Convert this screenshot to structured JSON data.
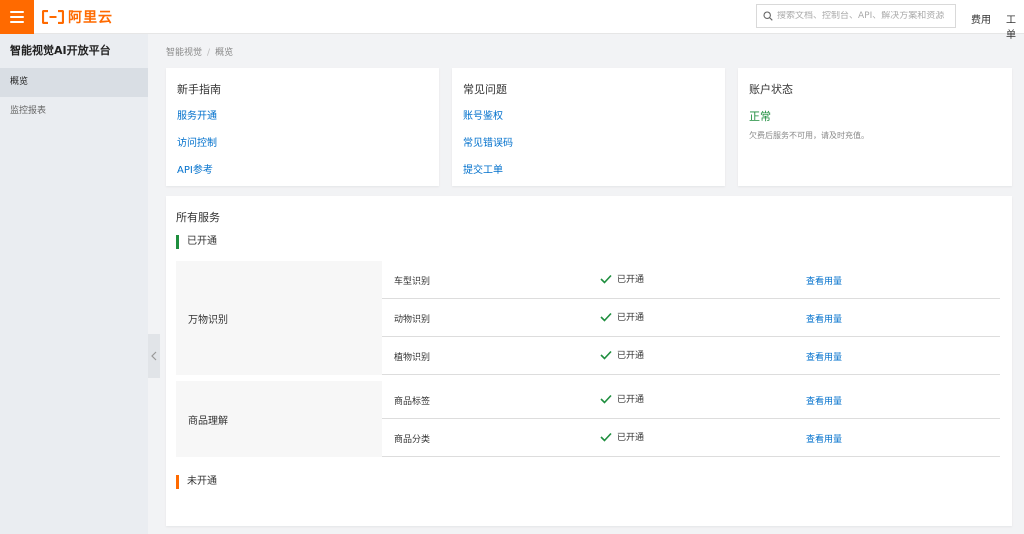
{
  "topbar": {
    "logo_text": "阿里云",
    "search_placeholder": "搜索文档、控制台、API、解决方案和资源",
    "links": [
      "费用",
      "工单"
    ],
    "brand_color": "#ff6a00"
  },
  "sidebar": {
    "title": "智能视觉AI开放平台",
    "items": [
      {
        "label": "概览",
        "active": true
      },
      {
        "label": "监控报表",
        "active": false
      }
    ]
  },
  "breadcrumb": [
    "智能视觉",
    "概览"
  ],
  "cards": {
    "guide": {
      "title": "新手指南",
      "links": [
        "服务开通",
        "访问控制",
        "API参考"
      ]
    },
    "faq": {
      "title": "常见问题",
      "links": [
        "账号鉴权",
        "常见错误码",
        "提交工单"
      ]
    },
    "account": {
      "title": "账户状态",
      "status": "正常",
      "note": "欠费后服务不可用，请及时充值。",
      "status_color": "#1e8e3e"
    }
  },
  "services": {
    "title": "所有服务",
    "enabled_label": "已开通",
    "disabled_label": "未开通",
    "groups": [
      {
        "name": "万物识别",
        "rows": [
          {
            "name": "车型识别",
            "state": "已开通",
            "action": "查看用量"
          },
          {
            "name": "动物识别",
            "state": "已开通",
            "action": "查看用量"
          },
          {
            "name": "植物识别",
            "state": "已开通",
            "action": "查看用量"
          }
        ]
      },
      {
        "name": "商品理解",
        "rows": [
          {
            "name": "商品标签",
            "state": "已开通",
            "action": "查看用量"
          },
          {
            "name": "商品分类",
            "state": "已开通",
            "action": "查看用量"
          }
        ]
      }
    ]
  }
}
